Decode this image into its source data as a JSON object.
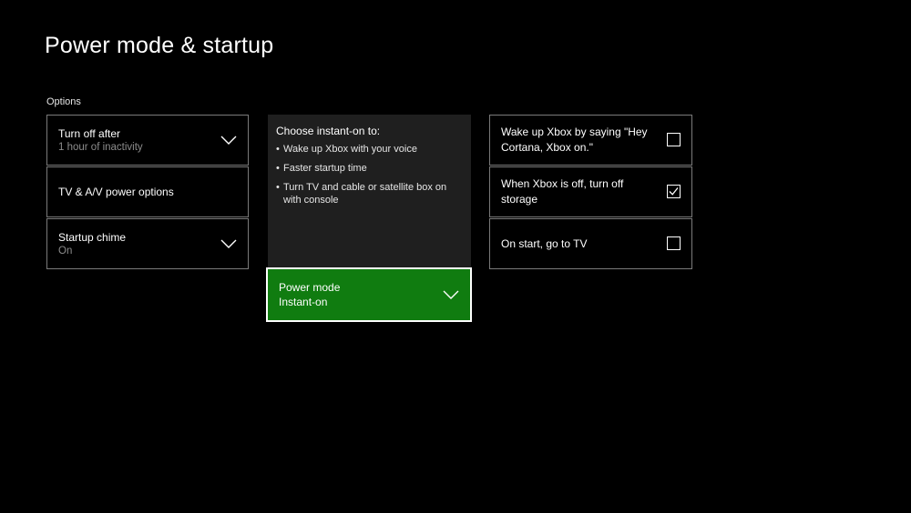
{
  "page": {
    "title": "Power mode & startup"
  },
  "options": {
    "section_label": "Options",
    "items": [
      {
        "primary": "Turn off after",
        "secondary": "1 hour of inactivity",
        "icon": "chevron-down-icon"
      },
      {
        "primary": "TV & A/V power options"
      },
      {
        "primary": "Startup chime",
        "secondary": "On",
        "icon": "chevron-down-icon"
      }
    ]
  },
  "info": {
    "heading": "Choose instant-on to:",
    "bullets": [
      "Wake up Xbox with your voice",
      "Faster startup time",
      "Turn TV and cable or satellite box on with console"
    ]
  },
  "power_mode": {
    "primary": "Power mode",
    "secondary": "Instant-on",
    "icon": "chevron-down-icon"
  },
  "checks": [
    {
      "label": "Wake up Xbox by saying \"Hey Cortana, Xbox on.\"",
      "checked": false
    },
    {
      "label": "When Xbox is off, turn off storage",
      "checked": true
    },
    {
      "label": "On start, go to TV",
      "checked": false
    }
  ],
  "colors": {
    "background": "#000000",
    "tile_border": "#7a7a7a",
    "accent_green": "#107c10",
    "info_panel": "#1f1f1f",
    "secondary_text": "#8c8c8c"
  }
}
